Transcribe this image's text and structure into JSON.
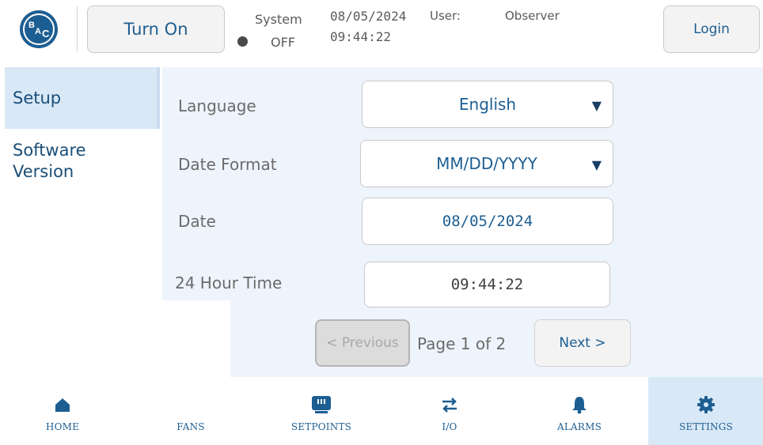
{
  "header": {
    "logo_text": "BAC",
    "turn_on_label": "Turn On",
    "system_label": "System",
    "system_status": "OFF",
    "date": "08/05/2024",
    "time": "09:44:22",
    "user_label": "User:",
    "user_value": "Observer",
    "login_label": "Login"
  },
  "sidebar": {
    "items": [
      {
        "label": "Setup",
        "active": true
      },
      {
        "label": "Software Version",
        "active": false
      }
    ]
  },
  "form": {
    "language": {
      "label": "Language",
      "value": "English"
    },
    "date_format": {
      "label": "Date Format",
      "value": "MM/DD/YYYY"
    },
    "date": {
      "label": "Date",
      "value": "08/05/2024"
    },
    "time": {
      "label": "24 Hour Time",
      "value": "09:44:22"
    }
  },
  "pagination": {
    "previous_label": "< Previous",
    "page_text": "Page 1 of 2",
    "next_label": "Next >"
  },
  "bottom_nav": [
    {
      "label": "HOME",
      "icon": "home-icon"
    },
    {
      "label": "FANS",
      "icon": "fan-icon"
    },
    {
      "label": "SETPOINTS",
      "icon": "setpoints-icon"
    },
    {
      "label": "I/O",
      "icon": "io-arrows-icon"
    },
    {
      "label": "ALARMS",
      "icon": "bell-icon"
    },
    {
      "label": "SETTINGS",
      "icon": "gear-icon",
      "active": true
    }
  ],
  "colors": {
    "accent": "#1d5e92",
    "panel_bg": "#eef4fb",
    "active_bg": "#d9e8f6"
  }
}
